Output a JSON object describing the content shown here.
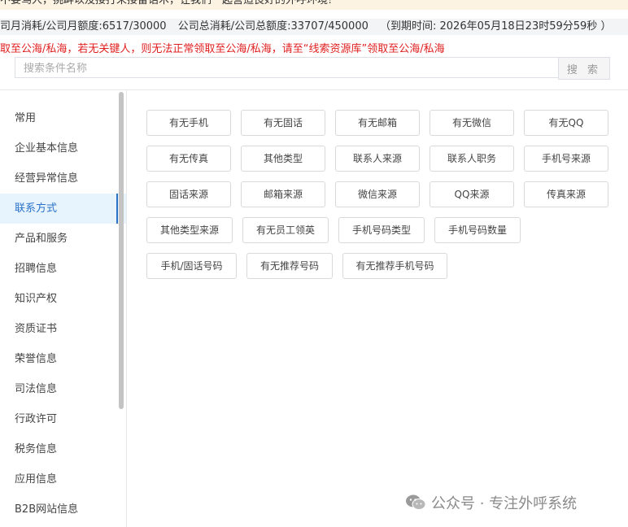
{
  "notice": {
    "text": "不要骂人，挑衅以及接打未接雷话术，让我们一起营造良好的外呼环境!"
  },
  "quota": {
    "monthly": "司月消耗/公司月额度:6517/30000",
    "total": "公司总消耗/公司总额度:33707/450000",
    "expiry": "（到期时间: 2026年05月18日23时59分59秒 ）"
  },
  "warning": {
    "text": "取至公海/私海，若无关键人，则无法正常领取至公海/私海，请至“线索资源库”领取至公海/私海"
  },
  "search": {
    "placeholder": "搜索条件名称",
    "button_label": "搜 索"
  },
  "sidebar": {
    "items": [
      {
        "label": "常用"
      },
      {
        "label": "企业基本信息"
      },
      {
        "label": "经营异常信息"
      },
      {
        "label": "联系方式"
      },
      {
        "label": "产品和服务"
      },
      {
        "label": "招聘信息"
      },
      {
        "label": "知识产权"
      },
      {
        "label": "资质证书"
      },
      {
        "label": "荣誉信息"
      },
      {
        "label": "司法信息"
      },
      {
        "label": "行政许可"
      },
      {
        "label": "税务信息"
      },
      {
        "label": "应用信息"
      },
      {
        "label": "B2B网站信息"
      }
    ],
    "active_index": 3
  },
  "tags": {
    "row1": [
      "有无手机",
      "有无固话",
      "有无邮箱",
      "有无微信",
      "有无QQ"
    ],
    "row2": [
      "有无传真",
      "其他类型",
      "联系人来源",
      "联系人职务",
      "手机号来源"
    ],
    "row3": [
      "固话来源",
      "邮箱来源",
      "微信来源",
      "QQ来源",
      "传真来源"
    ],
    "row4": [
      "其他类型来源",
      "有无员工领英",
      "手机号码类型",
      "手机号码数量"
    ],
    "row5": [
      "手机/固话号码",
      "有无推荐号码",
      "有无推荐手机号码"
    ]
  },
  "watermark": {
    "text": "公众号 · 专注外呼系统",
    "icon": "wechat-icon"
  },
  "colors": {
    "accent": "#2a72c8",
    "warning": "#e02020",
    "active_bg": "#e8f4fd"
  }
}
